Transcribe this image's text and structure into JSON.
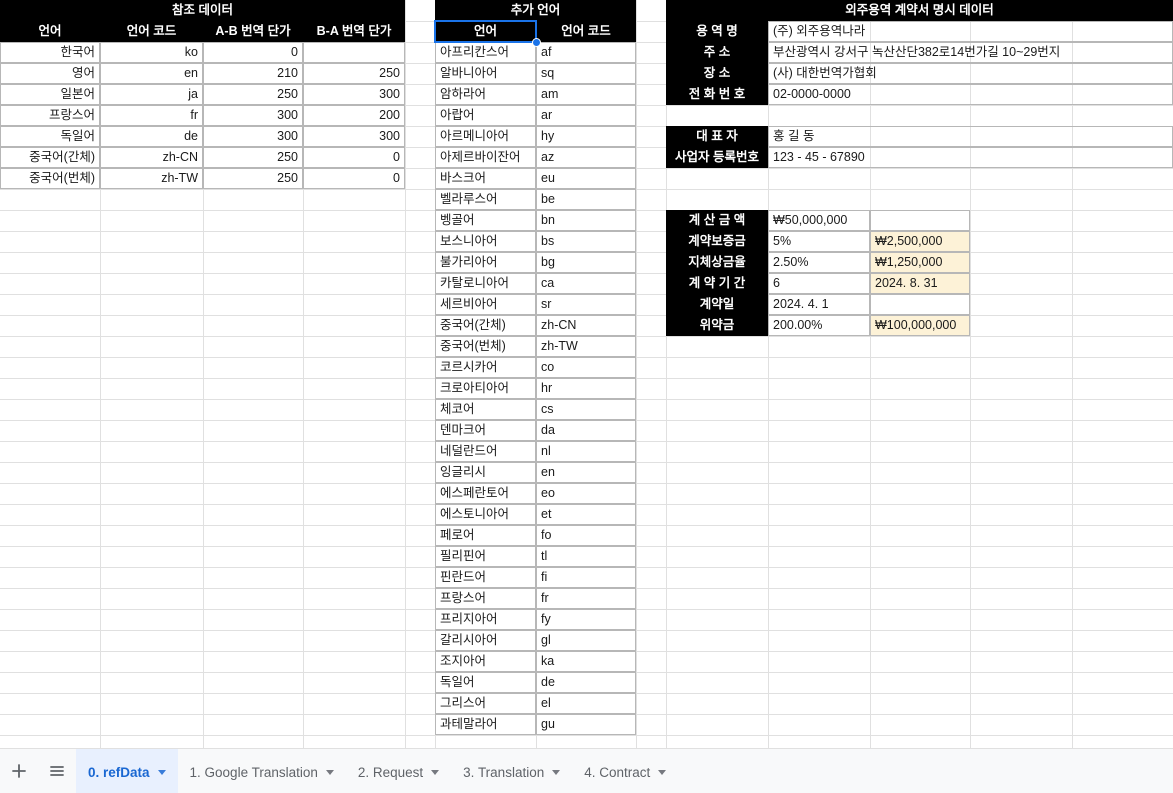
{
  "app": {
    "grid_line_color": "#e0e0e0",
    "header_bg": "#000000",
    "header_fg": "#ffffff",
    "highlight_bg": "#fdf2d7",
    "selection_color": "#1a73e8",
    "active_tab_bg": "#e8f0fe",
    "active_tab_fg": "#1967d2"
  },
  "ref_table": {
    "title": "참조 데이터",
    "columns": [
      "언어",
      "언어 코드",
      "A-B 번역 단가",
      "B-A 번역 단가"
    ],
    "rows": [
      {
        "language": "한국어",
        "code": "ko",
        "ab": "0",
        "ba": ""
      },
      {
        "language": "영어",
        "code": "en",
        "ab": "210",
        "ba": "250"
      },
      {
        "language": "일본어",
        "code": "ja",
        "ab": "250",
        "ba": "300"
      },
      {
        "language": "프랑스어",
        "code": "fr",
        "ab": "300",
        "ba": "200"
      },
      {
        "language": "독일어",
        "code": "de",
        "ab": "300",
        "ba": "300"
      },
      {
        "language": "중국어(간체)",
        "code": "zh-CN",
        "ab": "250",
        "ba": "0"
      },
      {
        "language": "중국어(번체)",
        "code": "zh-TW",
        "ab": "250",
        "ba": "0"
      }
    ]
  },
  "extra_table": {
    "title": "추가 언어",
    "columns": [
      "언어",
      "언어 코드"
    ],
    "selected_cell": "언어",
    "rows": [
      {
        "language": "아프리칸스어",
        "code": "af"
      },
      {
        "language": "알바니아어",
        "code": "sq"
      },
      {
        "language": "암하라어",
        "code": "am"
      },
      {
        "language": "아랍어",
        "code": "ar"
      },
      {
        "language": "아르메니아어",
        "code": "hy"
      },
      {
        "language": "아제르바이잔어",
        "code": "az"
      },
      {
        "language": "바스크어",
        "code": "eu"
      },
      {
        "language": "벨라루스어",
        "code": "be"
      },
      {
        "language": "벵골어",
        "code": "bn"
      },
      {
        "language": "보스니아어",
        "code": "bs"
      },
      {
        "language": "불가리아어",
        "code": "bg"
      },
      {
        "language": "카탈로니아어",
        "code": "ca"
      },
      {
        "language": "세르비아어",
        "code": "sr"
      },
      {
        "language": "중국어(간체)",
        "code": "zh-CN"
      },
      {
        "language": "중국어(번체)",
        "code": "zh-TW"
      },
      {
        "language": "코르시카어",
        "code": "co"
      },
      {
        "language": "크로아티아어",
        "code": "hr"
      },
      {
        "language": "체코어",
        "code": "cs"
      },
      {
        "language": "덴마크어",
        "code": "da"
      },
      {
        "language": "네덜란드어",
        "code": "nl"
      },
      {
        "language": "잉글리시",
        "code": "en"
      },
      {
        "language": "에스페란토어",
        "code": "eo"
      },
      {
        "language": "에스토니아어",
        "code": "et"
      },
      {
        "language": "페로어",
        "code": "fo"
      },
      {
        "language": "필리핀어",
        "code": "tl"
      },
      {
        "language": "핀란드어",
        "code": "fi"
      },
      {
        "language": "프랑스어",
        "code": "fr"
      },
      {
        "language": "프리지아어",
        "code": "fy"
      },
      {
        "language": "갈리시아어",
        "code": "gl"
      },
      {
        "language": "조지아어",
        "code": "ka"
      },
      {
        "language": "독일어",
        "code": "de"
      },
      {
        "language": "그리스어",
        "code": "el"
      },
      {
        "language": "과테말라어",
        "code": "gu"
      }
    ]
  },
  "contract_panel": {
    "title": "외주용역 계약서 명시 데이터",
    "company_rows": [
      {
        "label": "용  역  명",
        "value": "(주) 외주용역나라"
      },
      {
        "label": "주      소",
        "value": "부산광역시 강서구 녹산산단382로14번가길 10~29번지"
      },
      {
        "label": "장      소",
        "value": "(사) 대한번역가협회"
      },
      {
        "label": "전 화 번 호",
        "value": "02-0000-0000"
      }
    ],
    "rep_rows": [
      {
        "label": "대  표  자",
        "value": "홍 길 동"
      },
      {
        "label": "사업자 등록번호",
        "value": "123 - 45 - 67890"
      }
    ],
    "amount_rows": [
      {
        "label": "계 산 금 액",
        "value": "₩50,000,000",
        "extra": "",
        "extra_highlight": false
      },
      {
        "label": "계약보증금",
        "value": "5%",
        "extra": "₩2,500,000",
        "extra_highlight": true
      },
      {
        "label": "지체상금율",
        "value": "2.50%",
        "extra": "₩1,250,000",
        "extra_highlight": true
      },
      {
        "label": "계 약 기 간",
        "value": "6",
        "extra": "2024. 8. 31",
        "extra_highlight": true
      },
      {
        "label": "계약일",
        "value": "2024. 4. 1",
        "extra": "",
        "extra_highlight": false
      },
      {
        "label": "위약금",
        "value": "200.00%",
        "extra": "₩100,000,000",
        "extra_highlight": true
      }
    ]
  },
  "sheet_bar": {
    "add_sheet_label": "+",
    "all_sheets_label": "≡",
    "tabs": [
      {
        "label": "0. refData",
        "active": true
      },
      {
        "label": "1. Google Translation",
        "active": false
      },
      {
        "label": "2. Request",
        "active": false
      },
      {
        "label": "3. Translation",
        "active": false
      },
      {
        "label": "4. Contract",
        "active": false
      }
    ]
  }
}
